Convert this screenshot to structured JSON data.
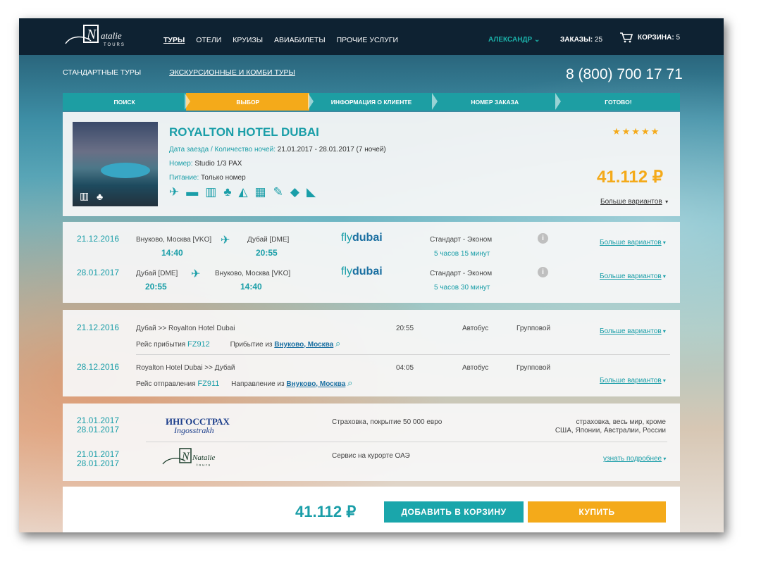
{
  "header": {
    "logo_text": "Natalie tours",
    "nav": [
      "ТУРЫ",
      "ОТЕЛИ",
      "КРУИЗЫ",
      "АВИАБИЛЕТЫ",
      "ПРОЧИЕ УСЛУГИ"
    ],
    "user": "АЛЕКСАНДР",
    "orders_label": "ЗАКАЗЫ:",
    "orders_count": "25",
    "cart_label": "КОРЗИНА:",
    "cart_count": "5"
  },
  "subnav": {
    "standard": "СТАНДАРТНЫЕ ТУРЫ",
    "excursion": "ЭКСКУРСИОННЫЕ И КОМБИ ТУРЫ",
    "phone": "8 (800) 700 17 71"
  },
  "steps": [
    "ПОИСК",
    "ВЫБОР",
    "ИНФОРМАЦИЯ О КЛИЕНТЕ",
    "НОМЕР ЗАКАЗА",
    "ГОТОВО!"
  ],
  "active_step": 1,
  "hotel": {
    "name": "ROYALTON HOTEL DUBAI",
    "dates_label": "Дата заезда / Количество ночей:",
    "dates_value": "21.01.2017 - 28.01.2017 (7 ночей)",
    "room_label": "Номер:",
    "room_value": "Studio 1/3 PAX",
    "food_label": "Питание:",
    "food_value": "Только номер",
    "stars": "★★★★★",
    "price": "41.112 ₽",
    "more": "Больше вариантов"
  },
  "flights": [
    {
      "date": "21.12.2016",
      "from": "Внуково, Москва [VKO]",
      "to": "Дубай [DME]",
      "dep": "14:40",
      "arr": "20:55",
      "airline_a": "fly",
      "airline_b": "dubai",
      "class": "Стандарт - Эконом",
      "duration": "5 часов 15 минут",
      "more": "Больше вариантов"
    },
    {
      "date": "28.01.2017",
      "from": "Дубай [DME]",
      "to": "Внуково, Москва [VKO]",
      "dep": "20:55",
      "arr": "14:40",
      "airline_a": "fly",
      "airline_b": "dubai",
      "class": "Стандарт - Эконом",
      "duration": "5 часов 30 минут",
      "more": "Больше вариантов"
    }
  ],
  "transfers": [
    {
      "date": "21.12.2016",
      "route": "Дубай >> Royalton Hotel Dubai",
      "time": "20:55",
      "transport": "Автобус",
      "type": "Групповой",
      "flight_label": "Рейс прибытия",
      "flight": "FZ912",
      "dir_label": "Прибытие из",
      "dir": "Внуково, Москва",
      "more": "Больше вариантов"
    },
    {
      "date": "28.12.2016",
      "route": "Royalton Hotel Dubai >> Дубай",
      "time": "04:05",
      "transport": "Автобус",
      "type": "Групповой",
      "flight_label": "Рейс отправления",
      "flight": "FZ911",
      "dir_label": "Направление из",
      "dir": "Внуково, Москва",
      "more": "Больше вариантов"
    }
  ],
  "services": [
    {
      "date1": "21.01.2017",
      "date2": "28.01.2017",
      "logo_a": "ИНГОССТРАХ",
      "logo_b": "Ingosstrakh",
      "desc": "Страховка, покрытие 50 000 евро",
      "note1": "страховка, весь мир, кроме",
      "note2": "США, Японии, Австралии, России"
    },
    {
      "date1": "21.01.2017",
      "date2": "28.01.2017",
      "logo_a": "Natalie",
      "logo_b": "tours",
      "desc": "Сервис на курорте ОАЭ",
      "link": "узнать подробнее"
    }
  ],
  "checkout": {
    "total": "41.112 ₽",
    "add_to_cart": "ДОБАВИТЬ В КОРЗИНУ",
    "buy": "КУПИТЬ"
  }
}
